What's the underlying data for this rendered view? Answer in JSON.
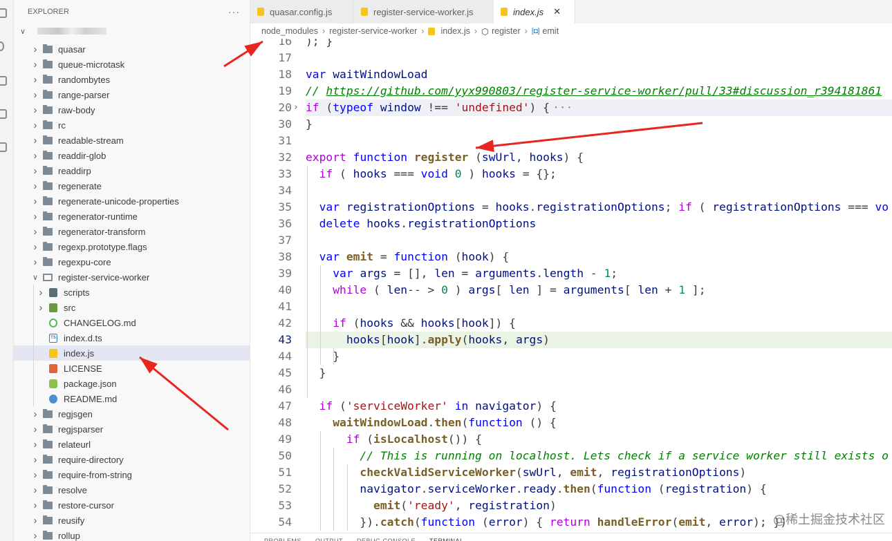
{
  "sidebar": {
    "title": "EXPLORER",
    "more_label": "···",
    "root_chevron": "∨",
    "items": [
      {
        "label": "quasar",
        "kind": "folder",
        "expanded": false,
        "depth": 1
      },
      {
        "label": "queue-microtask",
        "kind": "folder",
        "expanded": false,
        "depth": 1
      },
      {
        "label": "randombytes",
        "kind": "folder",
        "expanded": false,
        "depth": 1
      },
      {
        "label": "range-parser",
        "kind": "folder",
        "expanded": false,
        "depth": 1
      },
      {
        "label": "raw-body",
        "kind": "folder",
        "expanded": false,
        "depth": 1
      },
      {
        "label": "rc",
        "kind": "folder",
        "expanded": false,
        "depth": 1
      },
      {
        "label": "readable-stream",
        "kind": "folder",
        "expanded": false,
        "depth": 1
      },
      {
        "label": "readdir-glob",
        "kind": "folder",
        "expanded": false,
        "depth": 1
      },
      {
        "label": "readdirp",
        "kind": "folder",
        "expanded": false,
        "depth": 1
      },
      {
        "label": "regenerate",
        "kind": "folder",
        "expanded": false,
        "depth": 1
      },
      {
        "label": "regenerate-unicode-properties",
        "kind": "folder",
        "expanded": false,
        "depth": 1
      },
      {
        "label": "regenerator-runtime",
        "kind": "folder",
        "expanded": false,
        "depth": 1
      },
      {
        "label": "regenerator-transform",
        "kind": "folder",
        "expanded": false,
        "depth": 1
      },
      {
        "label": "regexp.prototype.flags",
        "kind": "folder",
        "expanded": false,
        "depth": 1
      },
      {
        "label": "regexpu-core",
        "kind": "folder",
        "expanded": false,
        "depth": 1
      },
      {
        "label": "register-service-worker",
        "kind": "folder",
        "expanded": true,
        "depth": 1
      },
      {
        "label": "scripts",
        "kind": "scripts",
        "expanded": false,
        "depth": 2
      },
      {
        "label": "src",
        "kind": "src",
        "expanded": false,
        "depth": 2
      },
      {
        "label": "CHANGELOG.md",
        "kind": "changelog",
        "depth": 2
      },
      {
        "label": "index.d.ts",
        "kind": "ts",
        "depth": 2
      },
      {
        "label": "index.js",
        "kind": "js",
        "depth": 2,
        "selected": true
      },
      {
        "label": "LICENSE",
        "kind": "license",
        "depth": 2
      },
      {
        "label": "package.json",
        "kind": "package",
        "depth": 2
      },
      {
        "label": "README.md",
        "kind": "readme",
        "depth": 2
      },
      {
        "label": "regjsgen",
        "kind": "folder",
        "expanded": false,
        "depth": 1
      },
      {
        "label": "regjsparser",
        "kind": "folder",
        "expanded": false,
        "depth": 1
      },
      {
        "label": "relateurl",
        "kind": "folder",
        "expanded": false,
        "depth": 1
      },
      {
        "label": "require-directory",
        "kind": "folder",
        "expanded": false,
        "depth": 1
      },
      {
        "label": "require-from-string",
        "kind": "folder",
        "expanded": false,
        "depth": 1
      },
      {
        "label": "resolve",
        "kind": "folder",
        "expanded": false,
        "depth": 1
      },
      {
        "label": "restore-cursor",
        "kind": "folder",
        "expanded": false,
        "depth": 1
      },
      {
        "label": "reusify",
        "kind": "folder",
        "expanded": false,
        "depth": 1
      },
      {
        "label": "rollup",
        "kind": "folder",
        "expanded": false,
        "depth": 1
      }
    ]
  },
  "tabs": [
    {
      "label": "quasar.config.js",
      "active": false
    },
    {
      "label": "register-service-worker.js",
      "active": false
    },
    {
      "label": "index.js",
      "active": true,
      "italic": true
    }
  ],
  "tab_close": "✕",
  "breadcrumb": {
    "parts": [
      "node_modules",
      "register-service-worker",
      "index.js",
      "register",
      "emit"
    ],
    "separator": "›"
  },
  "editor": {
    "current_line": 43,
    "lines": [
      {
        "n": "16",
        "tokens": [
          [
            "op",
            "); }"
          ]
        ]
      },
      {
        "n": "17",
        "tokens": []
      },
      {
        "n": "18",
        "tokens": [
          [
            "k",
            "var"
          ],
          [
            "op",
            " "
          ],
          [
            "v",
            "waitWindowLoad"
          ]
        ]
      },
      {
        "n": "19",
        "tokens": [
          [
            "c",
            "// "
          ],
          [
            "cu",
            "https://github.com/yyx990803/register-service-worker/pull/33#discussion_r394181861"
          ]
        ]
      },
      {
        "n": "20",
        "fold": true,
        "tokens": [
          [
            "cf",
            "if"
          ],
          [
            "op",
            " ("
          ],
          [
            "k",
            "typeof"
          ],
          [
            "op",
            " "
          ],
          [
            "v",
            "window"
          ],
          [
            "op",
            " !== "
          ],
          [
            "s",
            "'undefined'"
          ],
          [
            "op",
            ") {"
          ],
          [
            "fa",
            "···"
          ]
        ]
      },
      {
        "n": "30",
        "tokens": [
          [
            "op",
            "}"
          ]
        ]
      },
      {
        "n": "31",
        "tokens": []
      },
      {
        "n": "32",
        "tokens": [
          [
            "cf",
            "export"
          ],
          [
            "op",
            " "
          ],
          [
            "k",
            "function"
          ],
          [
            "op",
            " "
          ],
          [
            "fn",
            "register"
          ],
          [
            "op",
            " ("
          ],
          [
            "v",
            "swUrl"
          ],
          [
            "op",
            ", "
          ],
          [
            "v",
            "hooks"
          ],
          [
            "op",
            ") {"
          ]
        ]
      },
      {
        "n": "33",
        "tokens": [
          [
            "op",
            "  "
          ],
          [
            "cf",
            "if"
          ],
          [
            "op",
            " ( "
          ],
          [
            "v",
            "hooks"
          ],
          [
            "op",
            " === "
          ],
          [
            "k",
            "void"
          ],
          [
            "op",
            " "
          ],
          [
            "n",
            "0"
          ],
          [
            "op",
            " ) "
          ],
          [
            "v",
            "hooks"
          ],
          [
            "op",
            " = {};"
          ]
        ]
      },
      {
        "n": "34",
        "tokens": []
      },
      {
        "n": "35",
        "tokens": [
          [
            "op",
            "  "
          ],
          [
            "k",
            "var"
          ],
          [
            "op",
            " "
          ],
          [
            "v",
            "registrationOptions"
          ],
          [
            "op",
            " = "
          ],
          [
            "v",
            "hooks"
          ],
          [
            "op",
            "."
          ],
          [
            "v",
            "registrationOptions"
          ],
          [
            "op",
            "; "
          ],
          [
            "cf",
            "if"
          ],
          [
            "op",
            " ( "
          ],
          [
            "v",
            "registrationOptions"
          ],
          [
            "op",
            " === "
          ],
          [
            "k",
            "vo"
          ]
        ]
      },
      {
        "n": "36",
        "tokens": [
          [
            "op",
            "  "
          ],
          [
            "k",
            "delete"
          ],
          [
            "op",
            " "
          ],
          [
            "v",
            "hooks"
          ],
          [
            "op",
            "."
          ],
          [
            "v",
            "registrationOptions"
          ]
        ]
      },
      {
        "n": "37",
        "tokens": []
      },
      {
        "n": "38",
        "tokens": [
          [
            "op",
            "  "
          ],
          [
            "k",
            "var"
          ],
          [
            "op",
            " "
          ],
          [
            "fn",
            "emit"
          ],
          [
            "op",
            " = "
          ],
          [
            "k",
            "function"
          ],
          [
            "op",
            " ("
          ],
          [
            "v",
            "hook"
          ],
          [
            "op",
            ") {"
          ]
        ]
      },
      {
        "n": "39",
        "tokens": [
          [
            "op",
            "    "
          ],
          [
            "k",
            "var"
          ],
          [
            "op",
            " "
          ],
          [
            "v",
            "args"
          ],
          [
            "op",
            " = [], "
          ],
          [
            "v",
            "len"
          ],
          [
            "op",
            " = "
          ],
          [
            "v",
            "arguments"
          ],
          [
            "op",
            "."
          ],
          [
            "v",
            "length"
          ],
          [
            "op",
            " - "
          ],
          [
            "n",
            "1"
          ],
          [
            "op",
            ";"
          ]
        ]
      },
      {
        "n": "40",
        "tokens": [
          [
            "op",
            "    "
          ],
          [
            "cf",
            "while"
          ],
          [
            "op",
            " ( "
          ],
          [
            "v",
            "len"
          ],
          [
            "op",
            "-- > "
          ],
          [
            "n",
            "0"
          ],
          [
            "op",
            " ) "
          ],
          [
            "v",
            "args"
          ],
          [
            "op",
            "[ "
          ],
          [
            "v",
            "len"
          ],
          [
            "op",
            " ] = "
          ],
          [
            "v",
            "arguments"
          ],
          [
            "op",
            "[ "
          ],
          [
            "v",
            "len"
          ],
          [
            "op",
            " + "
          ],
          [
            "n",
            "1"
          ],
          [
            "op",
            " ];"
          ]
        ]
      },
      {
        "n": "41",
        "tokens": []
      },
      {
        "n": "42",
        "tokens": [
          [
            "op",
            "    "
          ],
          [
            "cf",
            "if"
          ],
          [
            "op",
            " ("
          ],
          [
            "v",
            "hooks"
          ],
          [
            "op",
            " && "
          ],
          [
            "v",
            "hooks"
          ],
          [
            "op",
            "["
          ],
          [
            "v",
            "hook"
          ],
          [
            "op",
            "]) {"
          ]
        ]
      },
      {
        "n": "43",
        "highlight": true,
        "tokens": [
          [
            "op",
            "      "
          ],
          [
            "v",
            "hooks"
          ],
          [
            "op",
            "["
          ],
          [
            "v",
            "hook"
          ],
          [
            "op",
            "]."
          ],
          [
            "fn",
            "apply"
          ],
          [
            "op",
            "("
          ],
          [
            "v",
            "hooks"
          ],
          [
            "op",
            ", "
          ],
          [
            "v",
            "args"
          ],
          [
            "op",
            ")"
          ]
        ]
      },
      {
        "n": "44",
        "tokens": [
          [
            "op",
            "    }"
          ]
        ]
      },
      {
        "n": "45",
        "tokens": [
          [
            "op",
            "  }"
          ]
        ]
      },
      {
        "n": "46",
        "tokens": []
      },
      {
        "n": "47",
        "tokens": [
          [
            "op",
            "  "
          ],
          [
            "cf",
            "if"
          ],
          [
            "op",
            " ("
          ],
          [
            "s",
            "'serviceWorker'"
          ],
          [
            "op",
            " "
          ],
          [
            "k",
            "in"
          ],
          [
            "op",
            " "
          ],
          [
            "v",
            "navigator"
          ],
          [
            "op",
            ") {"
          ]
        ]
      },
      {
        "n": "48",
        "tokens": [
          [
            "op",
            "    "
          ],
          [
            "fn",
            "waitWindowLoad"
          ],
          [
            "op",
            "."
          ],
          [
            "fn",
            "then"
          ],
          [
            "op",
            "("
          ],
          [
            "k",
            "function"
          ],
          [
            "op",
            " () {"
          ]
        ]
      },
      {
        "n": "49",
        "tokens": [
          [
            "op",
            "      "
          ],
          [
            "cf",
            "if"
          ],
          [
            "op",
            " ("
          ],
          [
            "fn",
            "isLocalhost"
          ],
          [
            "op",
            "()) {"
          ]
        ]
      },
      {
        "n": "50",
        "tokens": [
          [
            "op",
            "        "
          ],
          [
            "c",
            "// This is running on localhost. Lets check if a service worker still exists o"
          ]
        ]
      },
      {
        "n": "51",
        "tokens": [
          [
            "op",
            "        "
          ],
          [
            "fn",
            "checkValidServiceWorker"
          ],
          [
            "op",
            "("
          ],
          [
            "v",
            "swUrl"
          ],
          [
            "op",
            ", "
          ],
          [
            "fn",
            "emit"
          ],
          [
            "op",
            ", "
          ],
          [
            "v",
            "registrationOptions"
          ],
          [
            "op",
            ")"
          ]
        ]
      },
      {
        "n": "52",
        "tokens": [
          [
            "op",
            "        "
          ],
          [
            "v",
            "navigator"
          ],
          [
            "op",
            "."
          ],
          [
            "v",
            "serviceWorker"
          ],
          [
            "op",
            "."
          ],
          [
            "v",
            "ready"
          ],
          [
            "op",
            "."
          ],
          [
            "fn",
            "then"
          ],
          [
            "op",
            "("
          ],
          [
            "k",
            "function"
          ],
          [
            "op",
            " ("
          ],
          [
            "v",
            "registration"
          ],
          [
            "op",
            ") {"
          ]
        ]
      },
      {
        "n": "53",
        "tokens": [
          [
            "op",
            "          "
          ],
          [
            "fn",
            "emit"
          ],
          [
            "op",
            "("
          ],
          [
            "s",
            "'ready'"
          ],
          [
            "op",
            ", "
          ],
          [
            "v",
            "registration"
          ],
          [
            "op",
            ")"
          ]
        ]
      },
      {
        "n": "54",
        "tokens": [
          [
            "op",
            "        })."
          ],
          [
            "fn",
            "catch"
          ],
          [
            "op",
            "("
          ],
          [
            "k",
            "function"
          ],
          [
            "op",
            " ("
          ],
          [
            "v",
            "error"
          ],
          [
            "op",
            ") { "
          ],
          [
            "cf",
            "return"
          ],
          [
            "op",
            " "
          ],
          [
            "fn",
            "handleError"
          ],
          [
            "op",
            "("
          ],
          [
            "fn",
            "emit"
          ],
          [
            "op",
            ", "
          ],
          [
            "v",
            "error"
          ],
          [
            "op",
            "); })"
          ]
        ]
      }
    ]
  },
  "panel": {
    "tabs": [
      "PROBLEMS",
      "OUTPUT",
      "DEBUG CONSOLE",
      "TERMINAL"
    ]
  },
  "watermark": "@稀土掘金技术社区",
  "annotation_color": "#e8251f"
}
